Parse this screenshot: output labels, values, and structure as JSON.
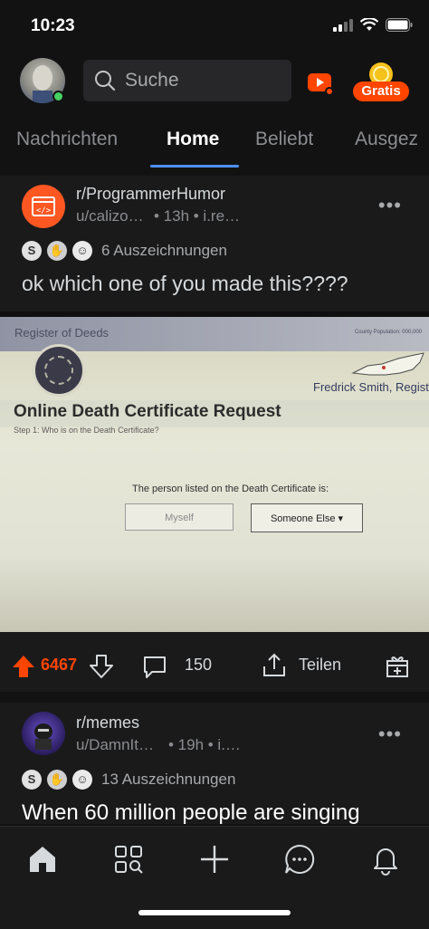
{
  "status_bar": {
    "time": "10:23"
  },
  "header": {
    "search_placeholder": "Suche",
    "gratis_label": "Gratis"
  },
  "tabs": [
    {
      "label": "Nachrichten"
    },
    {
      "label": "Home"
    },
    {
      "label": "Beliebt"
    },
    {
      "label": "Ausgez"
    }
  ],
  "posts": [
    {
      "subreddit": "r/ProgrammerHumor",
      "meta_user": "u/calizo…",
      "meta_rest": "• 13h • i.re…",
      "awards_label": "6 Auszeichnungen",
      "title": "ok which one of you made this????",
      "image": {
        "register_text": "Register of Deeds",
        "county_note": "County Population: 000,000",
        "registrar": "Fredrick Smith, Registrar",
        "form_title": "Online Death Certificate Request",
        "step": "Step 1: Who is on the Death Certificate?",
        "question": "The person listed on the Death Certificate is:",
        "option_myself": "Myself",
        "option_someone": "Someone Else ▾"
      },
      "votes": "6467",
      "comments": "150",
      "share_label": "Teilen"
    },
    {
      "subreddit": "r/memes",
      "meta_user": "u/DamnIt…",
      "meta_rest": "• 19h • i.…",
      "awards_label": "13 Auszeichnungen",
      "title": "When 60 million people are singing"
    }
  ],
  "colors": {
    "accent_orange": "#ff4500",
    "tab_underline": "#4f8ff7",
    "online": "#46d160"
  }
}
